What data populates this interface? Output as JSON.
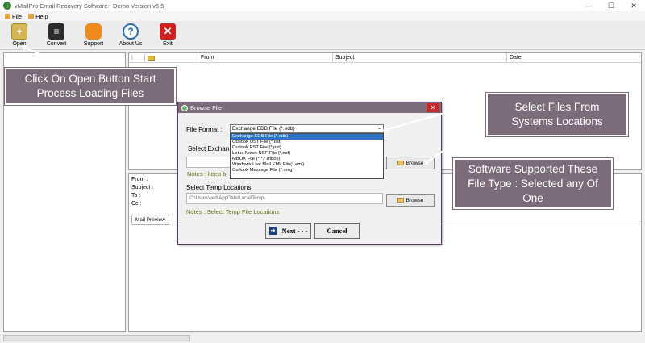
{
  "window": {
    "title": "vMailPro Email Recovery Software:- Demo Version v5.5",
    "minimize": "—",
    "maximize": "☐",
    "close": "✕"
  },
  "menu": {
    "items": [
      {
        "label": "File"
      },
      {
        "label": "Help"
      }
    ]
  },
  "toolbar": {
    "buttons": [
      {
        "label": "Open",
        "glyph": "+"
      },
      {
        "label": "Convert",
        "glyph": "≡"
      },
      {
        "label": "Support",
        "glyph": ""
      },
      {
        "label": "About Us",
        "glyph": "?"
      },
      {
        "label": "Exit",
        "glyph": "✕"
      }
    ]
  },
  "list": {
    "columns": [
      "From",
      "Subject",
      "Date"
    ]
  },
  "detail": {
    "from_label": "From :",
    "subject_label": "Subject :",
    "to_label": "To :",
    "cc_label": "Cc :",
    "tab_label": "Mail Preview"
  },
  "callouts": {
    "open": "Click On Open Button Start Process Loading Files",
    "files": "Select Files From Systems Locations",
    "types": "Software Supported These File Type : Selected any Of One"
  },
  "dialog": {
    "title": "Browse File",
    "close": "✕",
    "file_format_label": "File Format :",
    "selected_format": "Exchange EDB File (*.edb)",
    "options": [
      "Exchange EDB File (*.edb)",
      "Outlook OST File (*.ost)",
      "Outlook PST File (*.pst)",
      "Lotus Notes NSF File (*.nsf)",
      "MBOX File (*.*,*.mbox)",
      "Windows Live Mail EML File(*.eml)",
      "Outlook Message File (*.msg)"
    ],
    "select_exchange_label": "Select Exchan",
    "note_keep": "Notes : keep b",
    "browse_label": "Browse",
    "temp_label": "Select Temp Locations",
    "temp_path": "C:\\Users\\ved\\AppData\\Local\\Temp\\",
    "temp_note": "Notes :  Select Temp File Locations",
    "next_label": "Next - - -",
    "cancel_label": "Cancel"
  }
}
